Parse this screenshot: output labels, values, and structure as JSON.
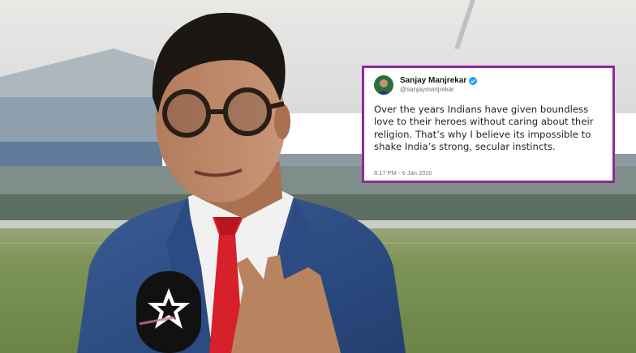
{
  "tweet": {
    "name": "Sanjay Manjrekar",
    "handle": "@sanjaymanjrekar",
    "text": "Over the years Indians have given boundless love to their heroes without caring about their religion. That’s why I believe its impossible to shake India’s strong, secular instincts.",
    "timestamp": "8:17 PM - 6 Jan 2020"
  },
  "colors": {
    "tweet_border": "#8e2a9c",
    "verified_badge": "#1da1f2",
    "tie": "#d6202b",
    "blazer": "#2f4f86",
    "pitch": "#6f8d52"
  }
}
